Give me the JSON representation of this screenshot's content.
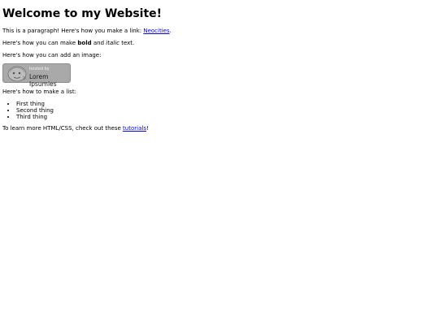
{
  "header": {
    "title": "Welcome to my Website!"
  },
  "intro": {
    "text_before": "This is a paragraph! Here's how you make a link: ",
    "link_label": "Neocities",
    "text_after": "."
  },
  "formatting": {
    "text_before": "Here's how you can make ",
    "bold_label": "bold",
    "text_middle": " and ",
    "italic_label": "italic",
    "text_after": " text."
  },
  "image_section": {
    "caption": "Here's how you can add an image:",
    "badge": {
      "small_text": "hosted by",
      "brand_text": "Lorem Ipsumies",
      "icon": "robot-head-icon",
      "background": "#a9a9a9"
    }
  },
  "list_section": {
    "caption": "Here's how to make a list:",
    "items": [
      "First thing",
      "Second thing",
      "Third thing"
    ]
  },
  "footer": {
    "text_before": "To learn more HTML/CSS, check out these ",
    "link_label": "tutorials",
    "text_after": "!"
  },
  "colors": {
    "link": "#0000ee",
    "text": "#000000",
    "background": "#ffffff"
  }
}
